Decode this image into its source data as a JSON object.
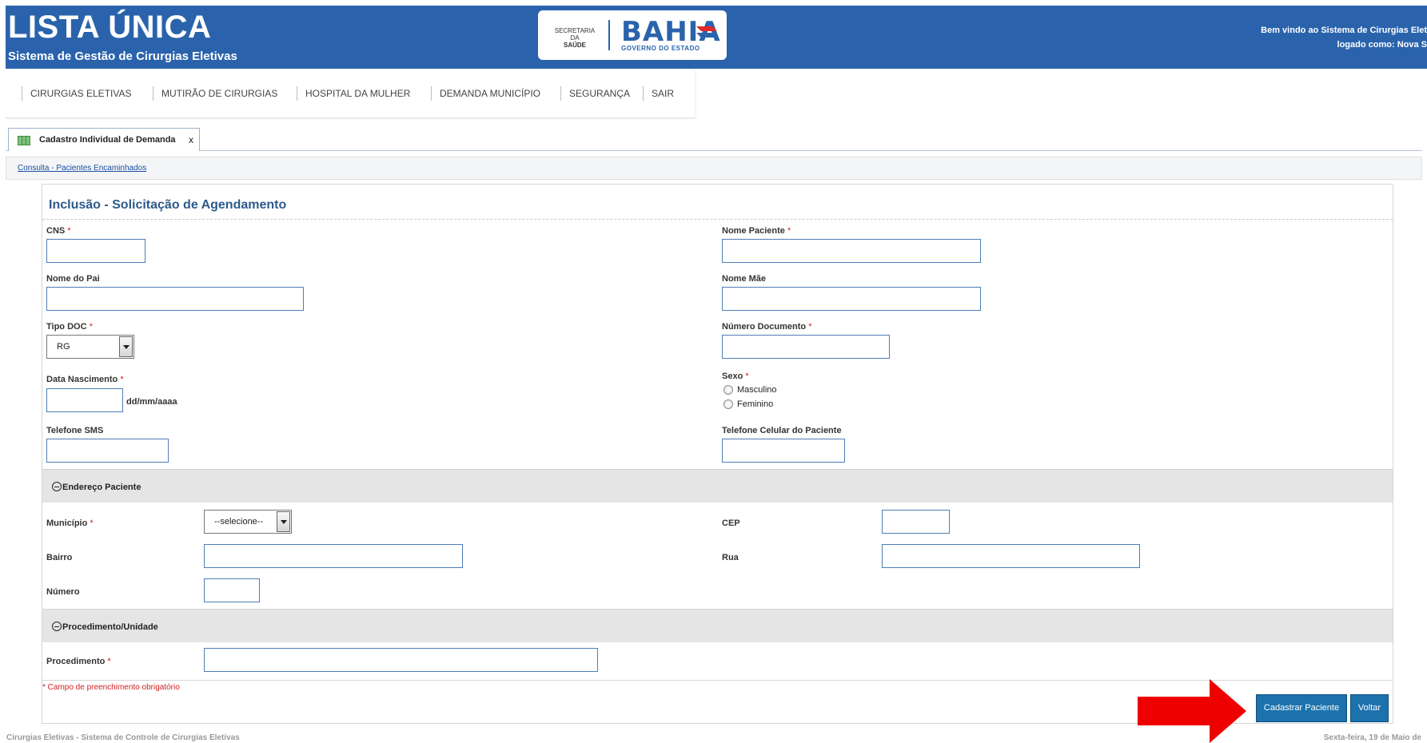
{
  "header": {
    "title": "LISTA ÚNICA",
    "subtitle": "Sistema de Gestão de Cirurgias Eletivas",
    "logo_secretaria_line1": "SECRETARIA DA",
    "logo_secretaria_line2": "SAÚDE",
    "logo_bahia": "BAHIA",
    "logo_governo": "GOVERNO DO ESTADO",
    "welcome_line1": "Bem vindo ao Sistema de Cirurgias Elet",
    "welcome_line2": "logado como: Nova S"
  },
  "menu": {
    "items": [
      "CIRURGIAS ELETIVAS",
      "MUTIRÃO DE CIRURGIAS",
      "HOSPITAL DA MULHER",
      "DEMANDA MUNICÍPIO",
      "SEGURANÇA",
      "SAIR"
    ]
  },
  "tab": {
    "label": "Cadastro Individual de Demanda",
    "close": "x"
  },
  "breadcrumb": {
    "link": "Consulta - Pacientes Encaminhados"
  },
  "form": {
    "title": "Inclusão - Solicitação de Agendamento",
    "required_mark": "*",
    "cns_label": "CNS",
    "nome_paciente_label": "Nome Paciente",
    "nome_pai_label": "Nome do Pai",
    "nome_mae_label": "Nome Mãe",
    "tipo_doc_label": "Tipo DOC",
    "tipo_doc_value": "RG",
    "numero_documento_label": "Número Documento",
    "data_nascimento_label": "Data Nascimento",
    "data_nascimento_hint": "dd/mm/aaaa",
    "sexo_label": "Sexo",
    "sexo_options": [
      "Masculino",
      "Feminino"
    ],
    "telefone_sms_label": "Telefone SMS",
    "telefone_celular_label": "Telefone Celular do Paciente",
    "endereco_section": "Endereço Paciente",
    "municipio_label": "Município",
    "municipio_value": "--selecione--",
    "cep_label": "CEP",
    "bairro_label": "Bairro",
    "rua_label": "Rua",
    "numero_label": "Número",
    "procedimento_section": "Procedimento/Unidade",
    "procedimento_label": "Procedimento",
    "required_note": "* Campo de preenchimento obrigatório"
  },
  "buttons": {
    "cadastrar": "Cadastrar Paciente",
    "voltar": "Voltar"
  },
  "footer": {
    "left": "Cirurgias Eletivas - Sistema de Controle de Cirurgias Eletivas",
    "right": "Sexta-feira, 19 de Maio de"
  },
  "colors": {
    "header_bg": "#2a63ac",
    "button_bg": "#1c72ad",
    "required": "#d21f1f",
    "arrow": "#ee0000"
  },
  "icons": [
    "table-icon",
    "close-icon",
    "collapse-icon",
    "chevron-down-icon",
    "arrow-right-icon"
  ]
}
